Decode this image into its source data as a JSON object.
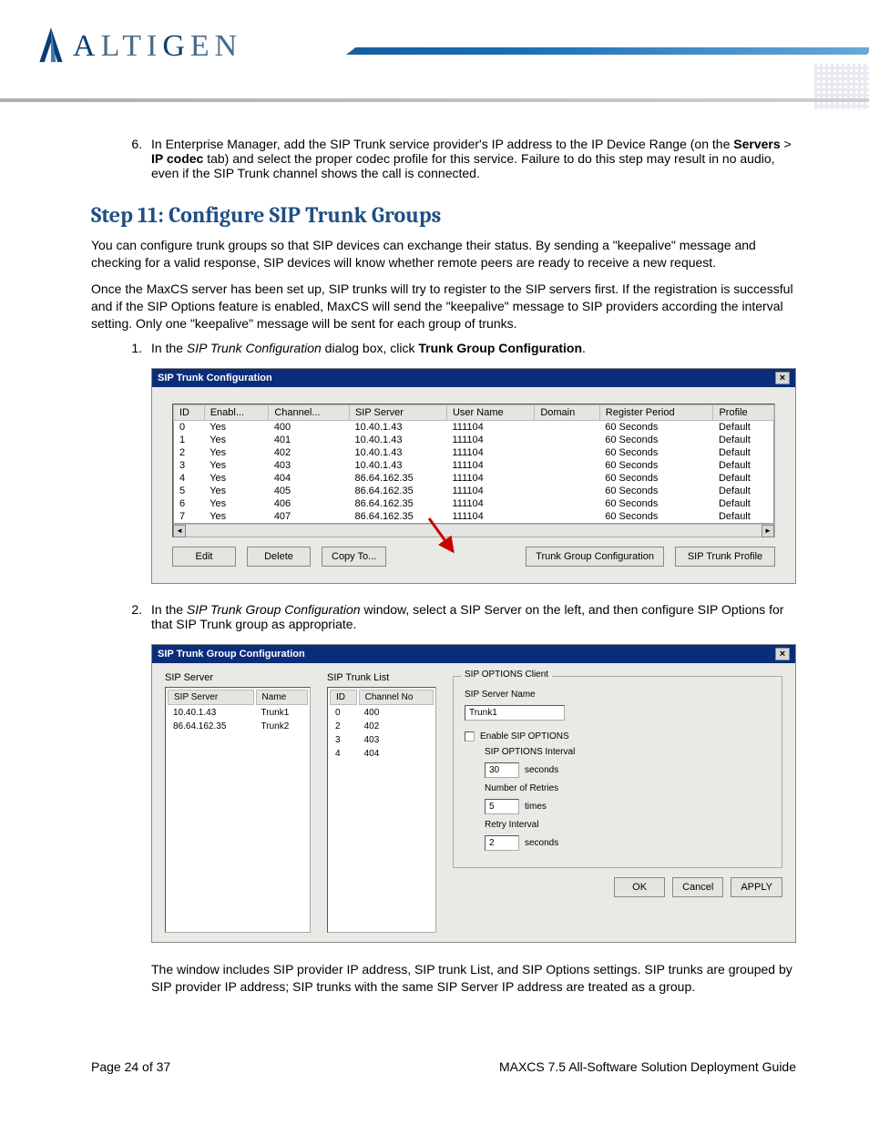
{
  "brand": "ALTIGEN",
  "step6": {
    "num": "6.",
    "text_a": "In Enterprise Manager, add the SIP Trunk service provider's IP address to the IP Device Range (on the ",
    "bold1": "Servers",
    "gt": " > ",
    "bold2": "IP codec",
    "text_b": " tab) and select the proper codec profile for this service. Failure to do this step may result in no audio, even if the SIP Trunk channel shows the call is connected."
  },
  "h2": "Step 11: Configure SIP Trunk Groups",
  "p1": "You can configure trunk groups so that SIP devices can exchange their status. By sending a \"keepalive\" message and checking for a valid response, SIP devices will know whether remote peers are ready to receive a new request.",
  "p2": "Once the MaxCS server has been set up, SIP trunks will try to register to the SIP servers first. If the registration is successful and if the SIP Options feature is enabled, MaxCS will send the \"keepalive\" message to SIP providers according the interval setting. Only one \"keepalive\" message will be sent for each group of trunks.",
  "li1": {
    "num": "1.",
    "a": "In the ",
    "em": "SIP Trunk Configuration",
    "b": " dialog box, click ",
    "bold": "Trunk Group Configuration",
    "c": "."
  },
  "dlg1": {
    "title": "SIP Trunk Configuration",
    "cols": [
      "ID",
      "Enabl...",
      "Channel...",
      "SIP Server",
      "User Name",
      "Domain",
      "Register Period",
      "Profile"
    ],
    "rows": [
      [
        "0",
        "Yes",
        "400",
        "10.40.1.43",
        "111104",
        "",
        "60 Seconds",
        "Default"
      ],
      [
        "1",
        "Yes",
        "401",
        "10.40.1.43",
        "111104",
        "",
        "60 Seconds",
        "Default"
      ],
      [
        "2",
        "Yes",
        "402",
        "10.40.1.43",
        "111104",
        "",
        "60 Seconds",
        "Default"
      ],
      [
        "3",
        "Yes",
        "403",
        "10.40.1.43",
        "111104",
        "",
        "60 Seconds",
        "Default"
      ],
      [
        "4",
        "Yes",
        "404",
        "86.64.162.35",
        "111104",
        "",
        "60 Seconds",
        "Default"
      ],
      [
        "5",
        "Yes",
        "405",
        "86.64.162.35",
        "111104",
        "",
        "60 Seconds",
        "Default"
      ],
      [
        "6",
        "Yes",
        "406",
        "86.64.162.35",
        "111104",
        "",
        "60 Seconds",
        "Default"
      ],
      [
        "7",
        "Yes",
        "407",
        "86.64.162.35",
        "111104",
        "",
        "60 Seconds",
        "Default"
      ]
    ],
    "btns": {
      "edit": "Edit",
      "delete": "Delete",
      "copy": "Copy To...",
      "tgc": "Trunk Group Configuration",
      "profile": "SIP Trunk Profile"
    }
  },
  "li2": {
    "num": "2.",
    "a": "In the ",
    "em": "SIP Trunk Group Configuration",
    "b": " window, select a SIP Server on the left, and then configure SIP Options for that SIP Trunk group as appropriate."
  },
  "dlg2": {
    "title": "SIP Trunk Group Configuration",
    "sipserver": {
      "label": "SIP Server",
      "cols": [
        "SIP Server",
        "Name"
      ],
      "rows": [
        [
          "10.40.1.43",
          "Trunk1"
        ],
        [
          "86.64.162.35",
          "Trunk2"
        ]
      ]
    },
    "trunklist": {
      "label": "SIP Trunk List",
      "cols": [
        "ID",
        "Channel No"
      ],
      "rows": [
        [
          "0",
          "400"
        ],
        [
          "2",
          "402"
        ],
        [
          "3",
          "403"
        ],
        [
          "4",
          "404"
        ]
      ]
    },
    "options": {
      "group": "SIP OPTIONS Client",
      "name_label": "SIP Server Name",
      "name_val": "Trunk1",
      "enable": "Enable SIP OPTIONS",
      "interval_label": "SIP OPTIONS Interval",
      "interval_val": "30",
      "interval_unit": "seconds",
      "retries_label": "Number of Retries",
      "retries_val": "5",
      "retries_unit": "times",
      "retryint_label": "Retry Interval",
      "retryint_val": "2",
      "retryint_unit": "seconds"
    },
    "btns": {
      "ok": "OK",
      "cancel": "Cancel",
      "apply": "APPLY"
    }
  },
  "p3": "The window includes SIP provider IP address, SIP trunk List, and SIP Options settings. SIP trunks are grouped by SIP provider IP address; SIP trunks with the same SIP Server IP address are treated as a group.",
  "footer": {
    "left": "Page 24 of 37",
    "right": "MAXCS 7.5 All-Software Solution Deployment Guide"
  }
}
